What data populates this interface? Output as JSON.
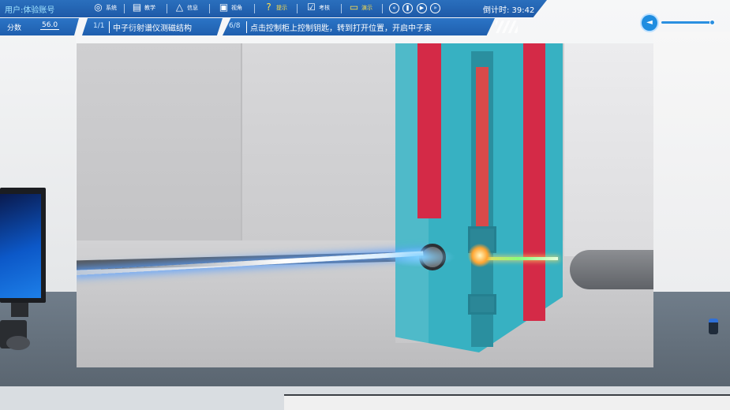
{
  "header": {
    "user_label": "用户:体验账号",
    "countdown": "倒计时: 39:42"
  },
  "toolbar": {
    "items": [
      {
        "label": "系统",
        "icon": "globe-icon"
      },
      {
        "label": "教学",
        "icon": "teaching-icon"
      },
      {
        "label": "信息",
        "icon": "warning-triangle-icon"
      },
      {
        "label": "视角",
        "icon": "image-view-icon"
      },
      {
        "label": "提示",
        "icon": "question-icon"
      },
      {
        "label": "考核",
        "icon": "clipboard-icon"
      },
      {
        "label": "演示",
        "icon": "monitor-icon"
      }
    ],
    "media": [
      "rewind-icon",
      "pause-icon",
      "play-icon",
      "fast-forward-icon"
    ]
  },
  "score": {
    "label": "分数",
    "value": "56.0"
  },
  "chapter": {
    "fraction": "1/1",
    "title": "中子衍射谱仪测磁结构"
  },
  "step": {
    "fraction": "6/8",
    "instruction": "点击控制柜上控制钥匙，转到打开位置，开启中子束"
  },
  "volume": {
    "icon": "speaker-icon",
    "level": 1.0
  },
  "colors": {
    "bar_blue": "#1f5fae",
    "hint_yellow": "#ffe04a",
    "apparatus_teal": "#37b1c2",
    "apparatus_red": "#d42a47"
  }
}
